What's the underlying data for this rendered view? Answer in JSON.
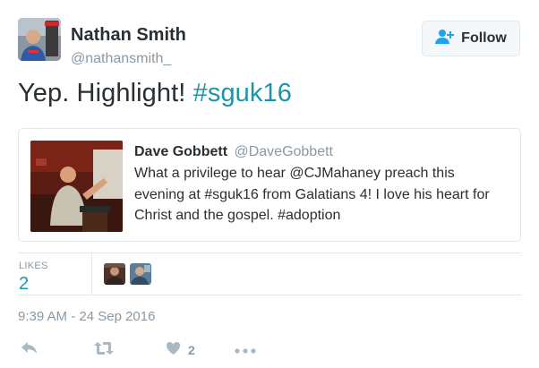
{
  "tweet": {
    "author_name": "Nathan Smith",
    "author_handle": "@nathansmith_",
    "text_plain": "Yep. Highlight! ",
    "hashtag": "#sguk16"
  },
  "follow": {
    "label": "Follow"
  },
  "quoted_tweet": {
    "author_name": "Dave Gobbett",
    "author_handle": "@DaveGobbett",
    "text": "What a privilege to hear @CJMahaney preach this evening at #sguk16 from Galatians 4! I love his heart for Christ and the gospel. #adoption"
  },
  "stats": {
    "likes_label": "LIKES",
    "likes_count": "2"
  },
  "timestamp": "9:39 AM - 24 Sep 2016",
  "actions": {
    "like_count": "2"
  },
  "colors": {
    "link": "#1b95a8",
    "text": "#292f33",
    "muted": "#8899a6",
    "border": "#e1e8ed",
    "follow_icon": "#1da1f2"
  },
  "icons": [
    "avatar",
    "follow-user-icon",
    "reply-icon",
    "retweet-icon",
    "heart-icon",
    "more-icon"
  ]
}
